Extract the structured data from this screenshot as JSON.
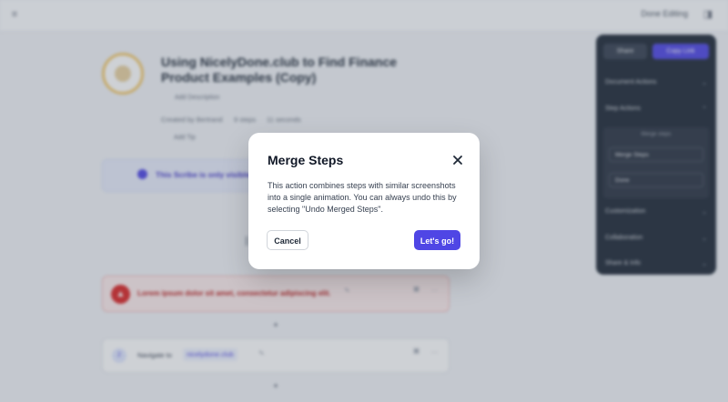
{
  "topbar": {
    "menu_icon": "menu-icon",
    "done_label": "Done Editing",
    "layout_icon": "panel-toggle-icon"
  },
  "document": {
    "title": "Using NicelyDone.club to Find Finance Product Examples (Copy)",
    "add_description": "Add Description",
    "created_by": "Created by Bertrand",
    "steps": "9 steps",
    "duration": "11 seconds",
    "add_tip": "Add Tip"
  },
  "banner": {
    "text": "This Scribe is only visible to you"
  },
  "alert_step": {
    "text": "Lorem ipsum dolor sit amet, consectetur adipiscing elit.",
    "icon": "alert-icon"
  },
  "nav_step": {
    "number": "2",
    "label": "Navigate to",
    "link": "nicelydone.club"
  },
  "side_panel": {
    "share_label": "Share",
    "copy_label": "Copy Link",
    "document_actions": "Document Actions",
    "step_actions": "Step Actions",
    "merge_hint": "Merge steps",
    "merge_steps": "Merge Steps",
    "done": "Done",
    "customization": "Customization",
    "collaboration": "Collaboration",
    "share_info": "Share & Info"
  },
  "modal": {
    "title": "Merge Steps",
    "body": "This action combines steps with similar screenshots into a single animation. You can always undo this by selecting \"Undo Merged Steps\".",
    "cancel_label": "Cancel",
    "confirm_label": "Let's go!"
  },
  "colors": {
    "accent": "#4f46e5",
    "alert": "#dc2626",
    "panel": "#1f2937"
  }
}
